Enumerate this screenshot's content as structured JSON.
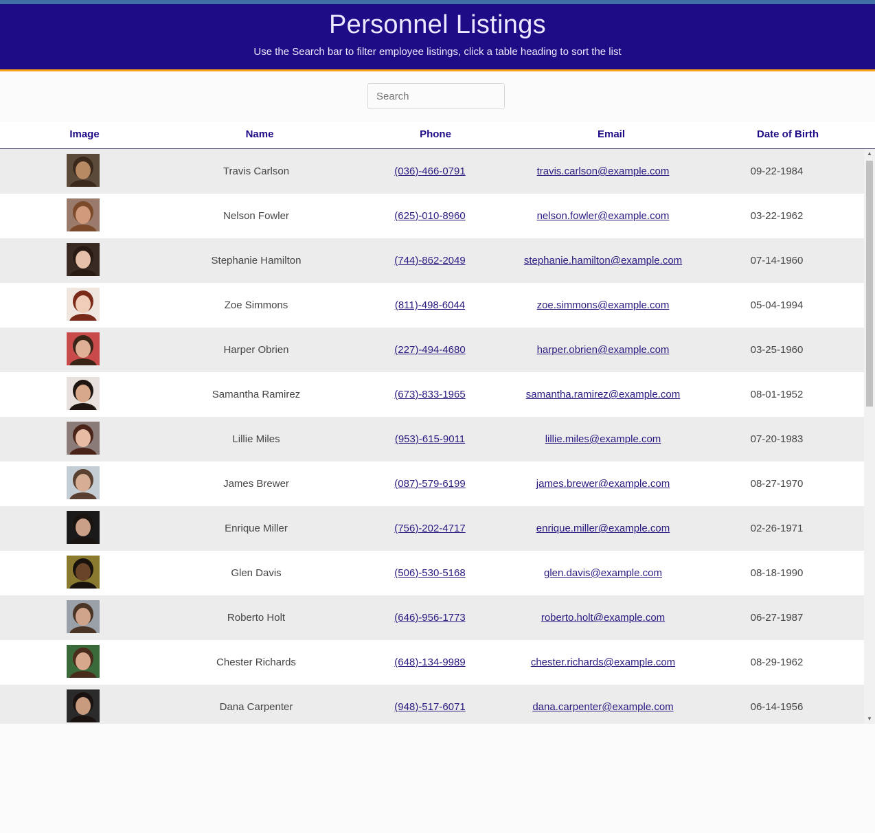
{
  "header": {
    "title": "Personnel Listings",
    "subtitle": "Use the Search bar to filter employee listings, click a table heading to sort the list"
  },
  "search": {
    "placeholder": "Search",
    "value": ""
  },
  "columns": {
    "image": "Image",
    "name": "Name",
    "phone": "Phone",
    "email": "Email",
    "dob": "Date of Birth"
  },
  "employees": [
    {
      "name": "Travis Carlson",
      "phone": "(036)-466-0791",
      "email": "travis.carlson@example.com",
      "dob": "09-22-1984",
      "skin": "#b88a64",
      "hair": "#3b2a1c",
      "bg": "#5b4a3a"
    },
    {
      "name": "Nelson Fowler",
      "phone": "(625)-010-8960",
      "email": "nelson.fowler@example.com",
      "dob": "03-22-1962",
      "skin": "#d29a7c",
      "hair": "#7a4a2a",
      "bg": "#9a7a6a"
    },
    {
      "name": "Stephanie Hamilton",
      "phone": "(744)-862-2049",
      "email": "stephanie.hamilton@example.com",
      "dob": "07-14-1960",
      "skin": "#e6c0a8",
      "hair": "#2a1a14",
      "bg": "#3a2a24"
    },
    {
      "name": "Zoe Simmons",
      "phone": "(811)-498-6044",
      "email": "zoe.simmons@example.com",
      "dob": "05-04-1994",
      "skin": "#f0cdb8",
      "hair": "#7a2a18",
      "bg": "#efe6e0"
    },
    {
      "name": "Harper Obrien",
      "phone": "(227)-494-4680",
      "email": "harper.obrien@example.com",
      "dob": "03-25-1960",
      "skin": "#e0b096",
      "hair": "#3a2418",
      "bg": "#c84a4a"
    },
    {
      "name": "Samantha Ramirez",
      "phone": "(673)-833-1965",
      "email": "samantha.ramirez@example.com",
      "dob": "08-01-1952",
      "skin": "#d8a88a",
      "hair": "#1e1410",
      "bg": "#e8e0dc"
    },
    {
      "name": "Lillie Miles",
      "phone": "(953)-615-9011",
      "email": "lillie.miles@example.com",
      "dob": "07-20-1983",
      "skin": "#e8bca4",
      "hair": "#4a2418",
      "bg": "#8a7a78"
    },
    {
      "name": "James Brewer",
      "phone": "(087)-579-6199",
      "email": "james.brewer@example.com",
      "dob": "08-27-1970",
      "skin": "#d6ae96",
      "hair": "#5a4030",
      "bg": "#c4ccd4"
    },
    {
      "name": "Enrique Miller",
      "phone": "(756)-202-4717",
      "email": "enrique.miller@example.com",
      "dob": "02-26-1971",
      "skin": "#caa088",
      "hair": "#1a1410",
      "bg": "#1a1a1a"
    },
    {
      "name": "Glen Davis",
      "phone": "(506)-530-5168",
      "email": "glen.davis@example.com",
      "dob": "08-18-1990",
      "skin": "#6a4428",
      "hair": "#1a120c",
      "bg": "#8a7a30"
    },
    {
      "name": "Roberto Holt",
      "phone": "(646)-956-1773",
      "email": "roberto.holt@example.com",
      "dob": "06-27-1987",
      "skin": "#d0a48a",
      "hair": "#4a3426",
      "bg": "#9aa0a8"
    },
    {
      "name": "Chester Richards",
      "phone": "(648)-134-9989",
      "email": "chester.richards@example.com",
      "dob": "08-29-1962",
      "skin": "#d8a88c",
      "hair": "#4a2c1c",
      "bg": "#3a6a3a"
    },
    {
      "name": "Dana Carpenter",
      "phone": "(948)-517-6071",
      "email": "dana.carpenter@example.com",
      "dob": "06-14-1956",
      "skin": "#c89a7e",
      "hair": "#1a1210",
      "bg": "#2a2a2a"
    }
  ]
}
